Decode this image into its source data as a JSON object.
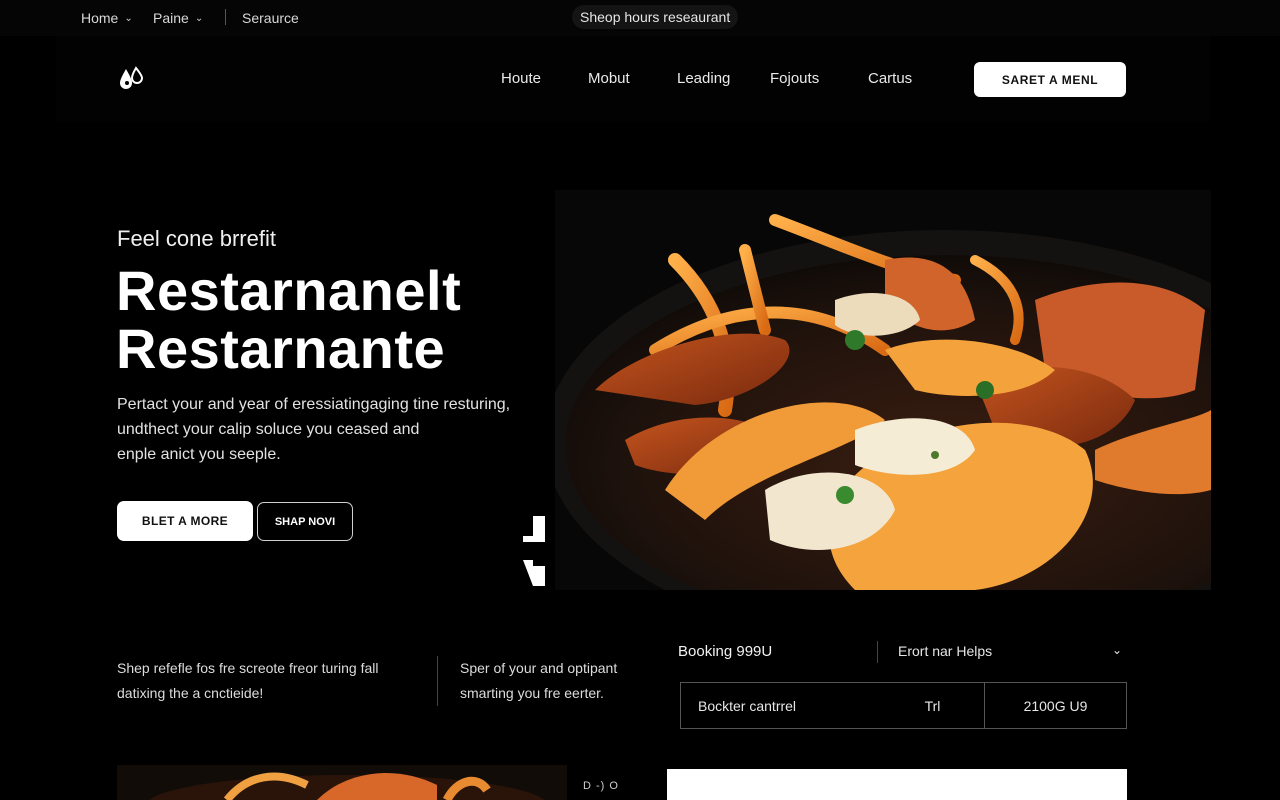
{
  "util_bar": {
    "home": "Home",
    "page": "Paine",
    "search": "Seraurce",
    "pill": "Sheop hours reseaurant"
  },
  "nav": {
    "links": [
      "Houte",
      "Mobut",
      "Leading",
      "Fojouts",
      "Cartus"
    ],
    "cta": "SARET A MENL"
  },
  "hero": {
    "kicker": "Feel cone brrefit",
    "title_line1": "Restarnanelt",
    "title_line2": "Restarnante",
    "desc_line1": "Pertact your and year of eressiatingaging tine resturing,",
    "desc_line2": "undthect your calip soluce you ceased and",
    "desc_line3": "enple anict you seeple.",
    "btn_primary": "BLET A MORE",
    "btn_outline": "SHAP NOVI"
  },
  "info": {
    "col1_line1": "Shep refefle fos fre screote freor turing fall",
    "col1_line2": "datixing the a cnctieide!",
    "col2_line1": "Sper of your and optipant",
    "col2_line2": "smarting you fre eerter."
  },
  "booking": {
    "label": "Booking 999U",
    "select_value": "Erort nar Helps",
    "row": [
      "Bockter cantrrel",
      "Trl",
      "2100G U9"
    ]
  },
  "bottom": {
    "mini_label": "D -) O"
  },
  "colors": {
    "background": "#000000",
    "text": "#ffffff",
    "button_bg": "#ffffff",
    "accent_food": "#e8892a"
  }
}
